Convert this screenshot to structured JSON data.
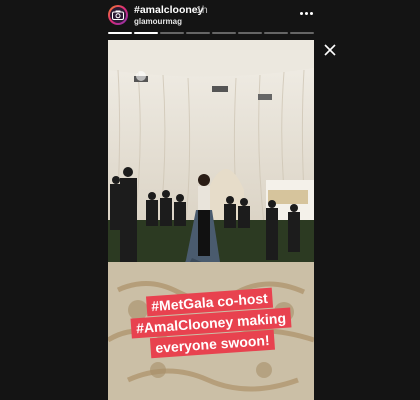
{
  "header": {
    "hashtag": "#amalclooney",
    "time": "1h",
    "account": "glamourmag",
    "avatar_icon": "camera-icon",
    "more_icon": "more-dots-icon"
  },
  "progress": {
    "segments": 8,
    "completed": 2
  },
  "close_icon": "close-icon",
  "caption": {
    "line1": "#MetGala co-host",
    "line2": "#AmalClooney making",
    "line3": "everyone swoon!",
    "background": "#e8424f"
  }
}
